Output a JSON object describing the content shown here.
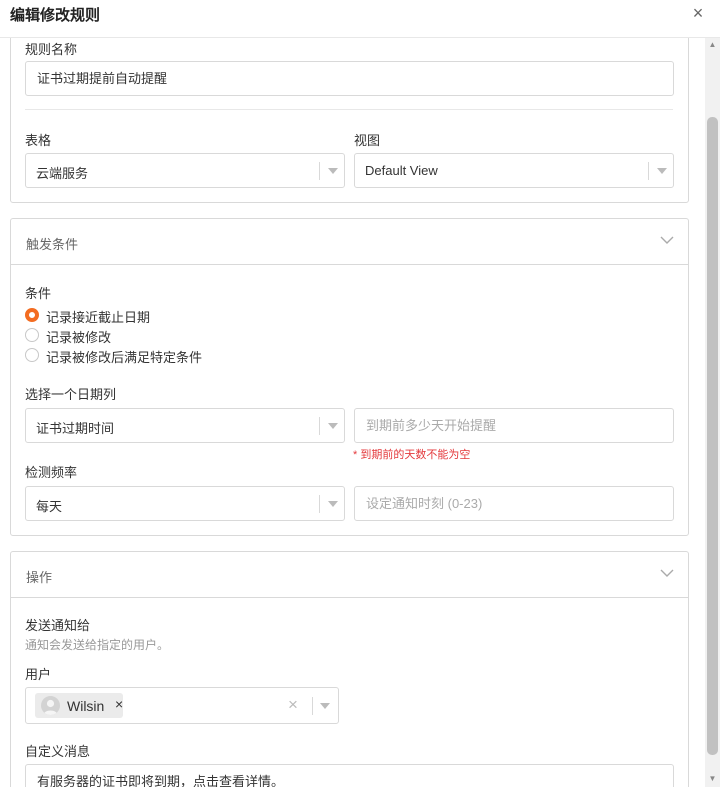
{
  "dialog": {
    "title": "编辑修改规则",
    "close_glyph": "×"
  },
  "rule": {
    "name_label": "规则名称",
    "name_value": "证书过期提前自动提醒",
    "table_label": "表格",
    "table_value": "云端服务",
    "view_label": "视图",
    "view_value": "Default View"
  },
  "trigger": {
    "title": "触发条件",
    "condition_label": "条件",
    "options": [
      {
        "label": "记录接近截止日期",
        "selected": true
      },
      {
        "label": "记录被修改",
        "selected": false
      },
      {
        "label": "记录被修改后满足特定条件",
        "selected": false
      }
    ],
    "date_column_label": "选择一个日期列",
    "date_column_value": "证书过期时间",
    "days_placeholder": "到期前多少天开始提醒",
    "days_error": "* 到期前的天数不能为空",
    "frequency_label": "检测频率",
    "frequency_value": "每天",
    "hour_placeholder": "设定通知时刻 (0-23)"
  },
  "action": {
    "title": "操作",
    "send_to_label": "发送通知给",
    "send_to_hint": "通知会发送给指定的用户。",
    "user_label": "用户",
    "users": [
      {
        "name": "Wilsin"
      }
    ],
    "tag_remove_glyph": "×",
    "clear_glyph": "×",
    "message_label": "自定义消息",
    "message_value": "有服务器的证书即将到期，点击查看详情。"
  },
  "colors": {
    "accent": "#f36c21",
    "error": "#e4393c",
    "border": "#d9d9d9"
  }
}
